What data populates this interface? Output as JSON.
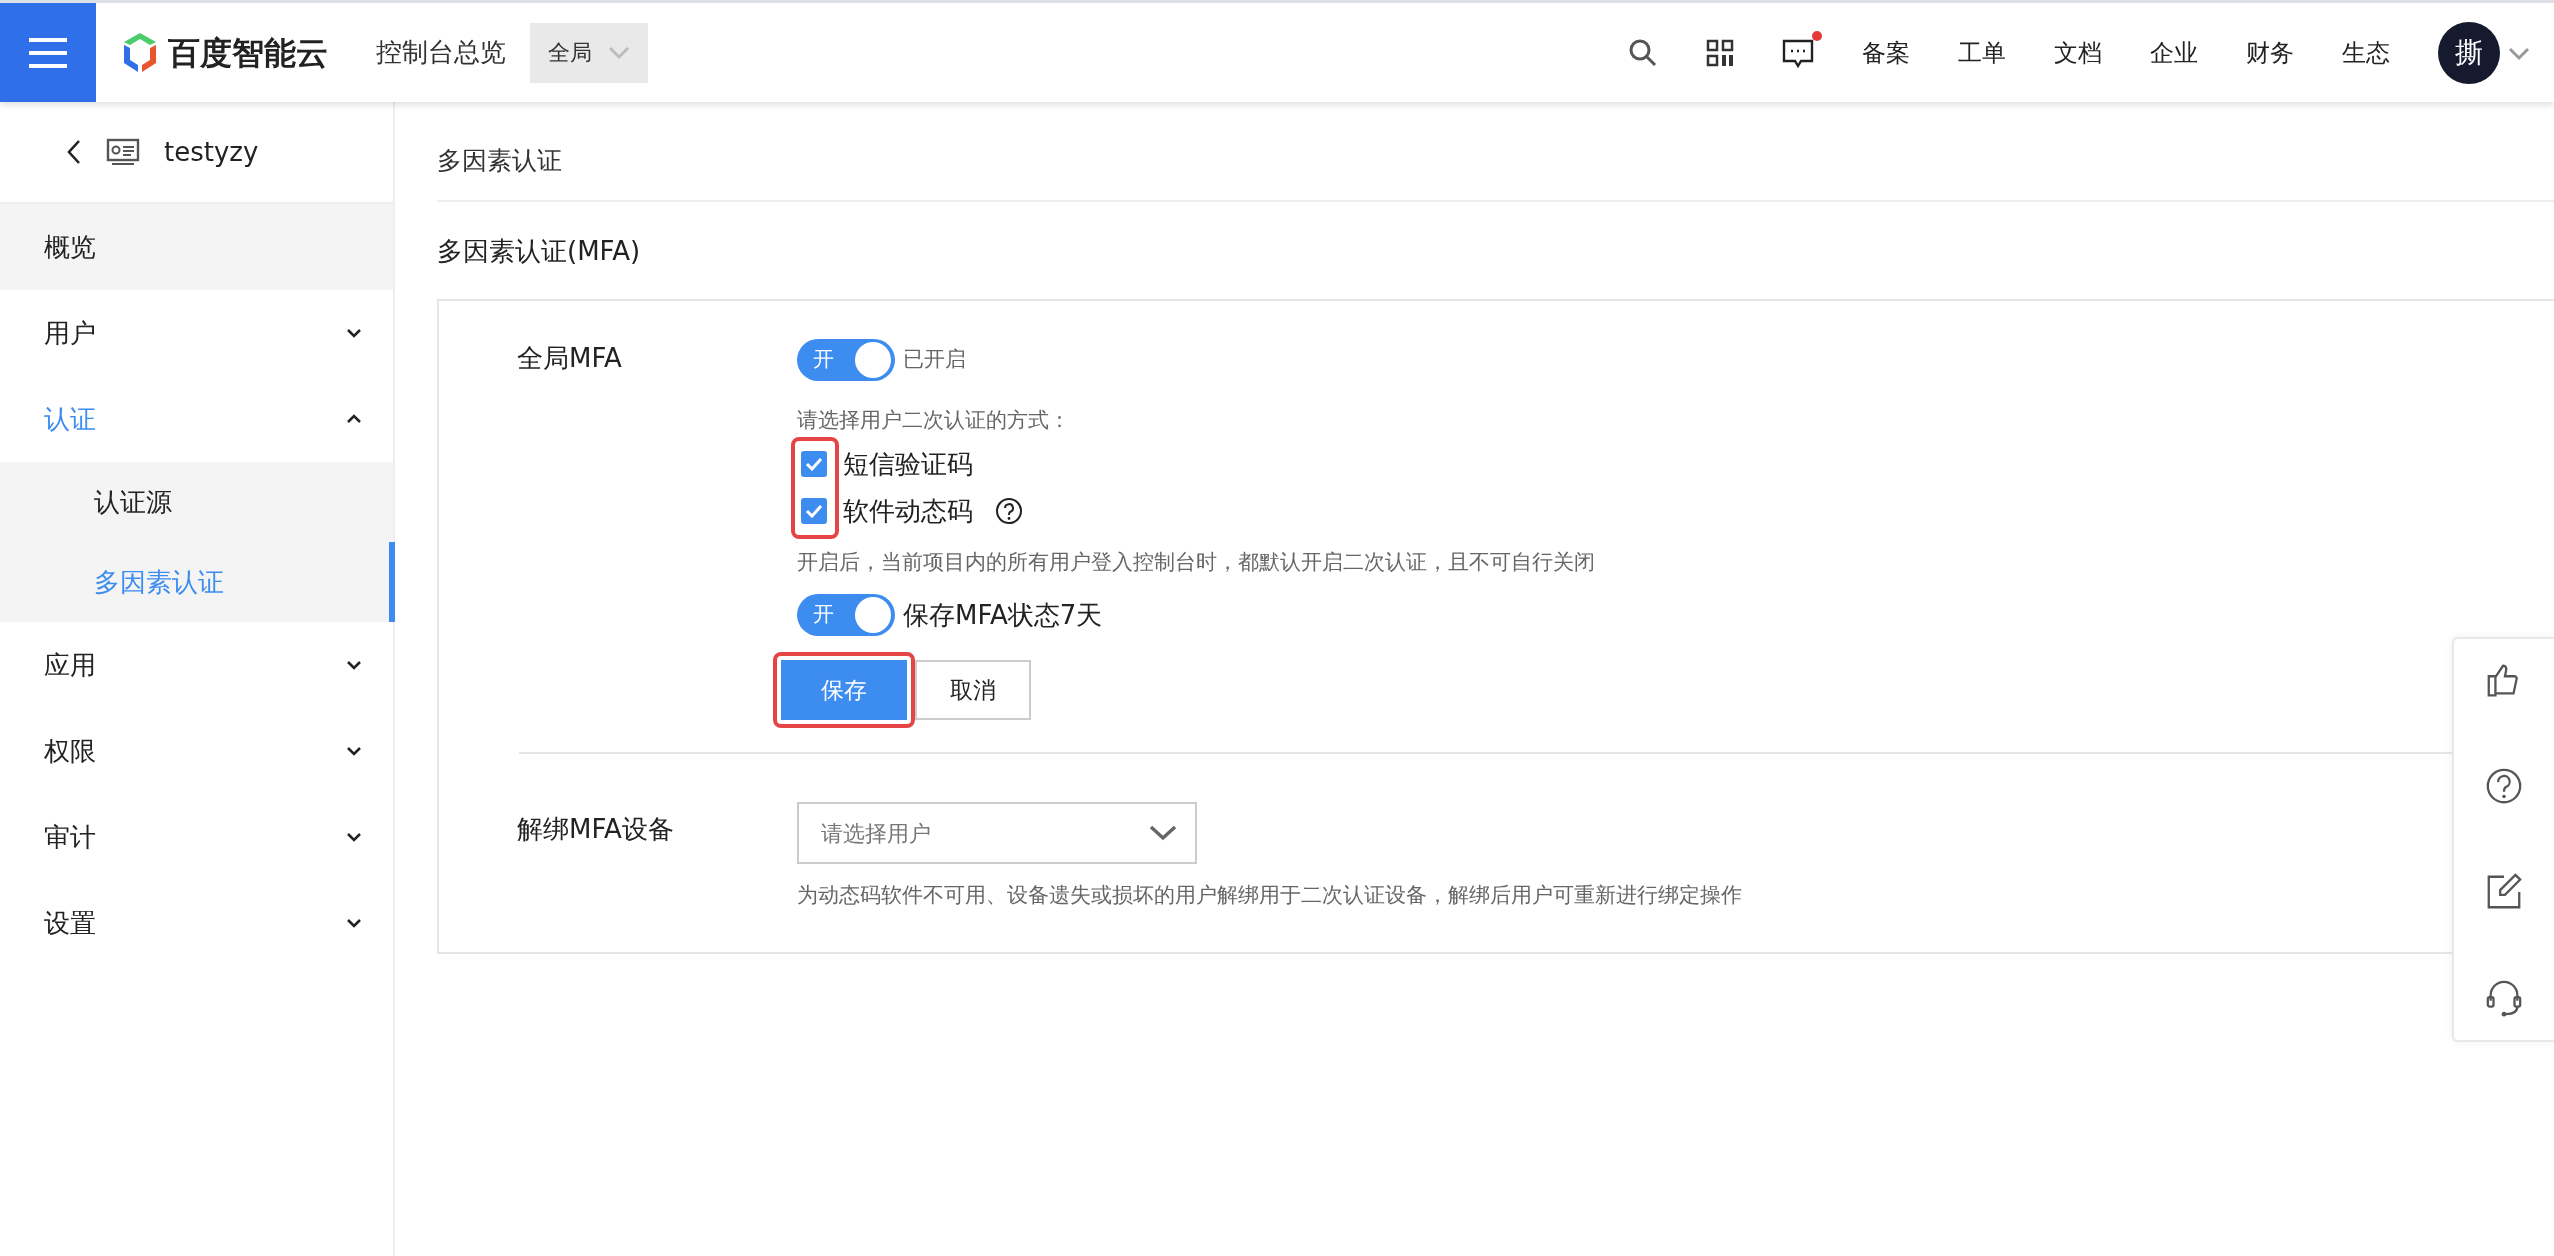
{
  "header": {
    "brand": "百度智能云",
    "console_title": "控制台总览",
    "region": "全局",
    "has_unread": true,
    "nav": [
      "备案",
      "工单",
      "文档",
      "企业",
      "财务",
      "生态"
    ],
    "avatar": "撕"
  },
  "sidebar": {
    "back_label": "testyzy",
    "items": [
      {
        "kind": "link",
        "label": "概览",
        "selected": false
      },
      {
        "kind": "group",
        "label": "用户",
        "selected": false,
        "expanded": false
      },
      {
        "kind": "group",
        "label": "认证",
        "selected": true,
        "expanded": true,
        "children": [
          {
            "label": "认证源",
            "selected": false
          },
          {
            "label": "多因素认证",
            "selected": true
          }
        ]
      },
      {
        "kind": "group",
        "label": "应用",
        "selected": false,
        "expanded": false
      },
      {
        "kind": "group",
        "label": "权限",
        "selected": false,
        "expanded": false
      },
      {
        "kind": "group",
        "label": "审计",
        "selected": false,
        "expanded": false
      },
      {
        "kind": "group",
        "label": "设置",
        "selected": false,
        "expanded": false
      }
    ]
  },
  "breadcrumb": "多因素认证",
  "section_title": "多因素认证(MFA)",
  "global_mfa": {
    "label": "全局MFA",
    "switch": {
      "text": "开",
      "on": true
    },
    "status": "已开启",
    "methods_prompt": "请选择用户二次认证的方式：",
    "methods": [
      {
        "label": "短信验证码",
        "checked": true
      },
      {
        "label": "软件动态码",
        "checked": true,
        "has_help": true
      }
    ],
    "note": "开启后，当前项目内的所有用户登入控制台时，都默认开启二次认证，且不可自行关闭",
    "remember": {
      "switch": {
        "text": "开",
        "on": true
      },
      "label": "保存MFA状态7天"
    },
    "buttons": {
      "save": "保存",
      "cancel": "取消"
    }
  },
  "unbind": {
    "label": "解绑MFA设备",
    "select": {
      "placeholder": "请选择用户"
    },
    "note": "为动态码软件不可用、设备遗失或损坏的用户解绑用于二次认证设备，解绑后用户可重新进行绑定操作"
  }
}
